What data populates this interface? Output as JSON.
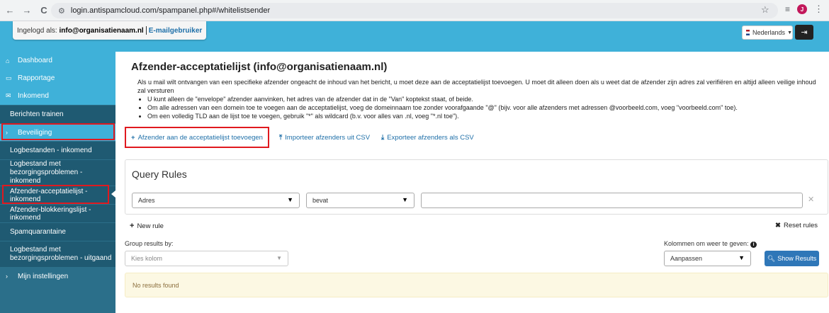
{
  "browser": {
    "url": "login.antispamcloud.com/spampanel.php#/whitelistsender",
    "back_icon": "←",
    "forward_icon": "→",
    "reload_icon": "C",
    "avatar_letter": "J"
  },
  "header": {
    "login_prefix": "Ingelogd als:",
    "login_email": "info@organisatienaam.nl",
    "login_role": "E-mailgebruiker",
    "language": "Nederlands"
  },
  "sidebar": {
    "items": [
      {
        "label": "Dashboard",
        "icon": "home-icon"
      },
      {
        "label": "Rapportage",
        "icon": "monitor-icon"
      },
      {
        "label": "Inkomend",
        "icon": "envelope-icon"
      },
      {
        "label": "Berichten trainen"
      },
      {
        "label": "Beveiliging",
        "icon": "chevron-right-icon"
      },
      {
        "label": "Logbestanden - inkomend"
      },
      {
        "label": "Logbestand met bezorgingsproblemen - inkomend"
      },
      {
        "label": "Afzender-acceptatielijst - inkomend"
      },
      {
        "label": "Afzender-blokkeringslijst - inkomend"
      },
      {
        "label": "Spamquarantaine"
      },
      {
        "label": "Logbestand met bezorgingsproblemen - uitgaand"
      },
      {
        "label": "Mijn instellingen",
        "icon": "chevron-right-icon"
      }
    ]
  },
  "main": {
    "title": "Afzender-acceptatielijst (info@organisatienaam.nl)",
    "description": "Als u mail wilt ontvangen van een specifieke afzender ongeacht de inhoud van het bericht, u moet deze aan de acceptatielijst toevoegen. U moet dit alleen doen als u weet dat de afzender zijn adres zal verifiëren en altijd alleen veilige inhoud zal versturen",
    "bullets": [
      "U kunt alleen de \"envelope\" afzender aanvinken, het adres van de afzender dat in de \"Van\" koptekst staat, of beide.",
      "Om alle adressen van een domein toe te voegen aan de acceptatielijst, voeg de domeinnaam toe zonder voorafgaande \"@\" (bijv. voor alle afzenders met adressen @voorbeeld.com, voeg \"voorbeeld.com\" toe).",
      "Om een volledig TLD aan de lijst toe te voegen, gebruik \"*\" als wildcard (b.v. voor alles van .nl, voeg \"*.nl toe\")."
    ],
    "actions": {
      "add": "Afzender aan de acceptatielijst toevoegen",
      "import": "Importeer afzenders uit CSV",
      "export": "Exporteer afzenders als CSV"
    },
    "query": {
      "title": "Query Rules",
      "field_value": "Adres",
      "operator_value": "bevat",
      "value_input": ""
    },
    "new_rule": "New rule",
    "reset_rules": "Reset rules",
    "group_label": "Group results by:",
    "group_placeholder": "Kies kolom",
    "columns_label": "Kolommen om weer te geven:",
    "columns_value": "Aanpassen",
    "show_results": "Show Results",
    "no_results": "No results found"
  }
}
